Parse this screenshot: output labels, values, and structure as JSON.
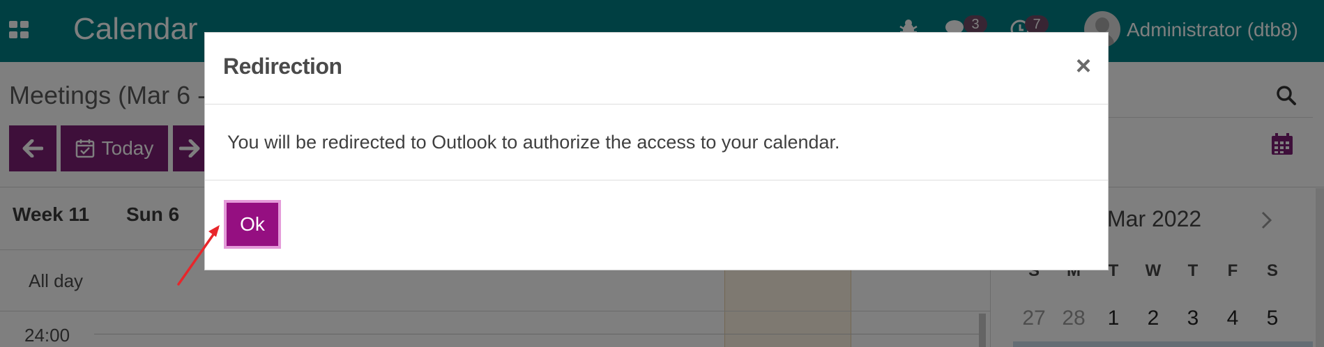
{
  "navbar": {
    "app_title": "Calendar",
    "messages_count": "3",
    "activities_count": "7",
    "user_name": "Administrator (dtb8)",
    "icons": [
      "apps-icon",
      "bug-icon",
      "chat-icon",
      "clock-icon",
      "avatar"
    ]
  },
  "control_panel": {
    "breadcrumb": "Meetings (Mar 6 -",
    "today_label": "Today"
  },
  "calendar": {
    "week_label": "Week 11",
    "day_label": "Sun 6",
    "allday_label": "All day",
    "time_label": "24:00"
  },
  "mini_calendar": {
    "title": "Mar 2022",
    "days_of_week": [
      "S",
      "M",
      "T",
      "W",
      "T",
      "F",
      "S"
    ],
    "first_row": [
      "27",
      "28",
      "1",
      "2",
      "3",
      "4",
      "5"
    ]
  },
  "modal": {
    "title": "Redirection",
    "close_symbol": "×",
    "message": "You will be redirected to Outlook to authorize the access to your calendar.",
    "ok_label": "Ok"
  },
  "colors": {
    "navbar": "#017e84",
    "primary": "#7c1e74",
    "ok_button": "#950f81",
    "annotation_arrow": "#e8262b"
  }
}
